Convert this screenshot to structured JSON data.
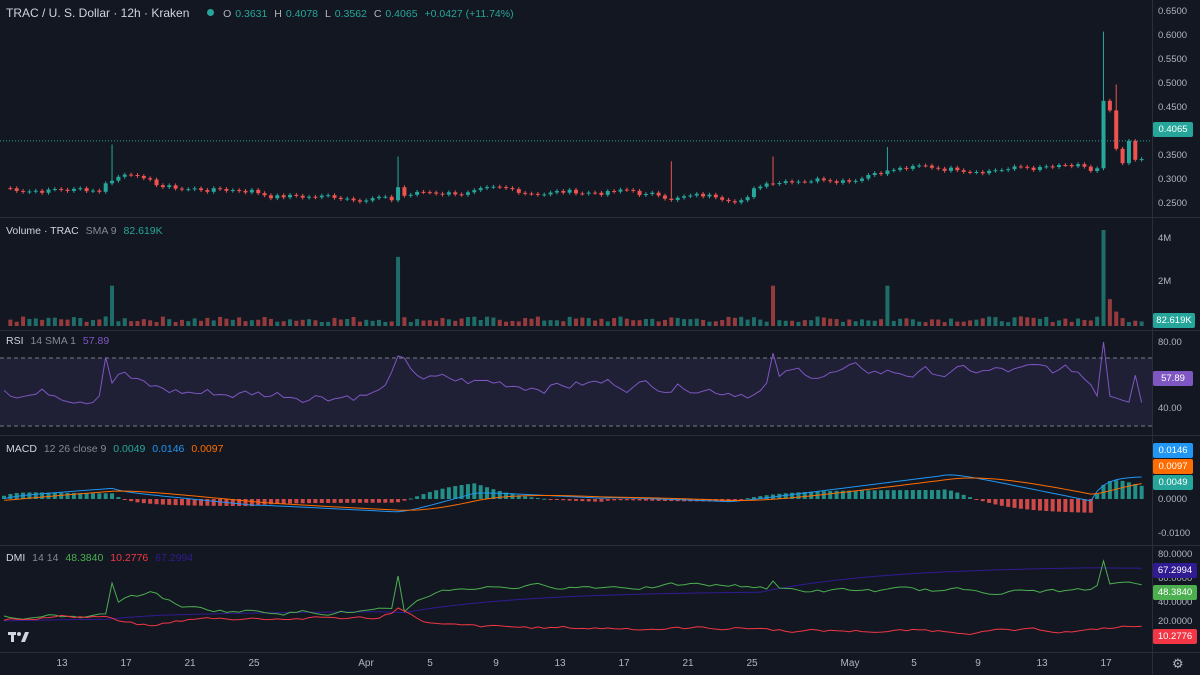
{
  "header": {
    "title": "TRAC / U. S. Dollar · 12h · Kraken",
    "o_label": "O",
    "o_val": "0.3631",
    "h_label": "H",
    "h_val": "0.4078",
    "l_label": "L",
    "l_val": "0.3562",
    "c_label": "C",
    "c_val": "0.4065",
    "change": "+0.0427 (+11.74%)"
  },
  "price_axis": {
    "ticks": [
      "0.6500",
      "0.6000",
      "0.5500",
      "0.5000",
      "0.4500",
      "0.3500",
      "0.3000",
      "0.2500"
    ],
    "current": "0.4065"
  },
  "volume": {
    "title": "Volume · TRAC",
    "sma_label": "SMA 9",
    "sma_value": "82.619K",
    "ticks": [
      "4M",
      "2M"
    ],
    "badge": "82.619K"
  },
  "rsi": {
    "title": "RSI",
    "params": "14 SMA 1",
    "value": "57.89",
    "ticks": [
      "80.00",
      "40.00"
    ],
    "badge": "57.89"
  },
  "macd": {
    "title": "MACD",
    "params": "12 26 close 9",
    "hist": "0.0049",
    "macd": "0.0146",
    "signal": "0.0097",
    "ticks": [
      "0.0000",
      "-0.0100"
    ],
    "badge_macd": "0.0146",
    "badge_signal": "0.0097",
    "badge_hist": "0.0049"
  },
  "dmi": {
    "title": "DMI",
    "params": "14 14",
    "plus": "48.3840",
    "minus": "10.2776",
    "adx": "67.2994",
    "ticks": [
      "80.0000",
      "60.0000",
      "40.0000",
      "20.0000"
    ],
    "badge_adx": "67.2994",
    "badge_plus": "48.3840",
    "badge_minus": "10.2776"
  },
  "time_axis": [
    "13",
    "17",
    "21",
    "25",
    "Apr",
    "5",
    "9",
    "13",
    "17",
    "21",
    "25",
    "May",
    "5",
    "9",
    "13",
    "17"
  ],
  "colors": {
    "up": "#26a69a",
    "down": "#ef5350",
    "rsi": "#7e57c2",
    "macd": "#2962ff",
    "signal": "#ff6d00",
    "plus_di": "#4caf50",
    "minus_di": "#f23645",
    "adx": "#311b92"
  },
  "icons": {
    "logo": "tradingview-logo-icon",
    "settings": "gear-icon"
  }
}
